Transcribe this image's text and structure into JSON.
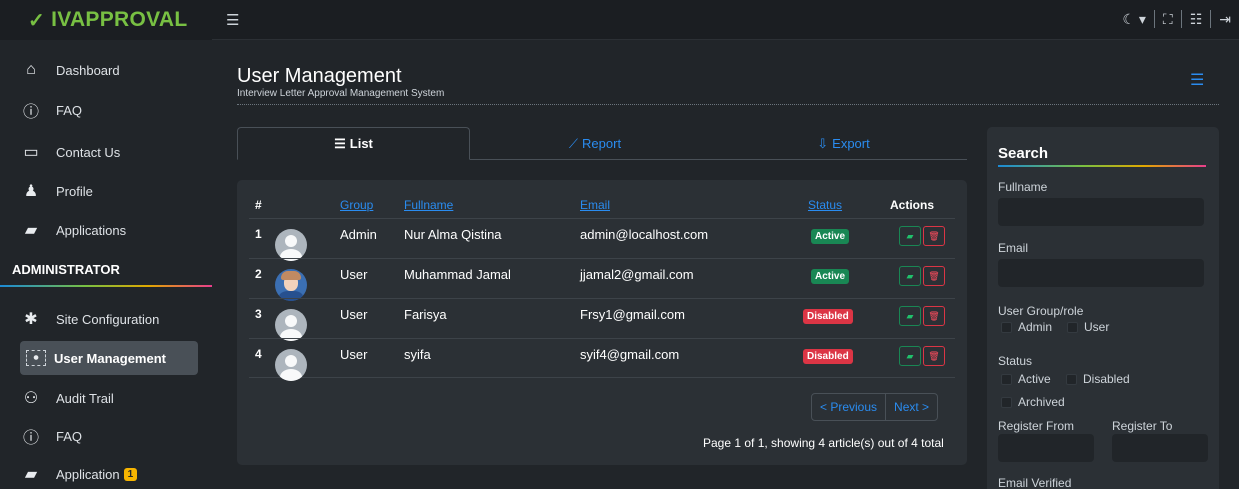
{
  "brand": {
    "name": "IVAPPROVAL",
    "accent": "#78c043"
  },
  "topbar": {
    "icons": [
      "menu-icon",
      "theme-icon",
      "fullscreen-icon",
      "list-icon",
      "logout-icon"
    ]
  },
  "sidebar": {
    "items": [
      {
        "label": "Dashboard",
        "icon": "dashboard-icon"
      },
      {
        "label": "FAQ",
        "icon": "help-icon"
      },
      {
        "label": "Contact Us",
        "icon": "chat-icon"
      },
      {
        "label": "Profile",
        "icon": "user-icon"
      },
      {
        "label": "Applications",
        "icon": "folder-icon"
      }
    ],
    "admin_header": "ADMINISTRATOR",
    "admin_items": [
      {
        "label": "Site Configuration",
        "icon": "gear-icon"
      },
      {
        "label": "User Management",
        "icon": "users-icon",
        "active": true
      },
      {
        "label": "Audit Trail",
        "icon": "sitemap-icon"
      },
      {
        "label": "FAQ",
        "icon": "help-icon"
      },
      {
        "label": "Application",
        "icon": "folder-icon",
        "badge": "1"
      }
    ]
  },
  "page": {
    "title": "User Management",
    "subtitle": "Interview Letter Approval Management System"
  },
  "tabs": [
    {
      "label": "List",
      "active": true
    },
    {
      "label": "Report"
    },
    {
      "label": "Export"
    }
  ],
  "table": {
    "headers": {
      "num": "#",
      "group": "Group",
      "fullname": "Fullname",
      "email": "Email",
      "status": "Status",
      "actions": "Actions"
    },
    "rows": [
      {
        "num": "1",
        "group": "Admin",
        "fullname": "Nur Alma Qistina",
        "email": "admin@localhost.com",
        "status": "Active"
      },
      {
        "num": "2",
        "group": "User",
        "fullname": "Muhammad Jamal",
        "email": "jjamal2@gmail.com",
        "status": "Active"
      },
      {
        "num": "3",
        "group": "User",
        "fullname": "Farisya",
        "email": "Frsy1@gmail.com",
        "status": "Disabled"
      },
      {
        "num": "4",
        "group": "User",
        "fullname": "syifa",
        "email": "syif4@gmail.com",
        "status": "Disabled"
      }
    ],
    "prev": "< Previous",
    "next": "Next >",
    "page_info": "Page 1 of 1, showing 4 article(s) out of 4 total"
  },
  "search": {
    "title": "Search",
    "fullname_label": "Fullname",
    "email_label": "Email",
    "group_label": "User Group/role",
    "group_admin": "Admin",
    "group_user": "User",
    "status_label": "Status",
    "status_active": "Active",
    "status_disabled": "Disabled",
    "status_archived": "Archived",
    "register_from": "Register From",
    "register_to": "Register To",
    "email_verified": "Email Verified"
  }
}
